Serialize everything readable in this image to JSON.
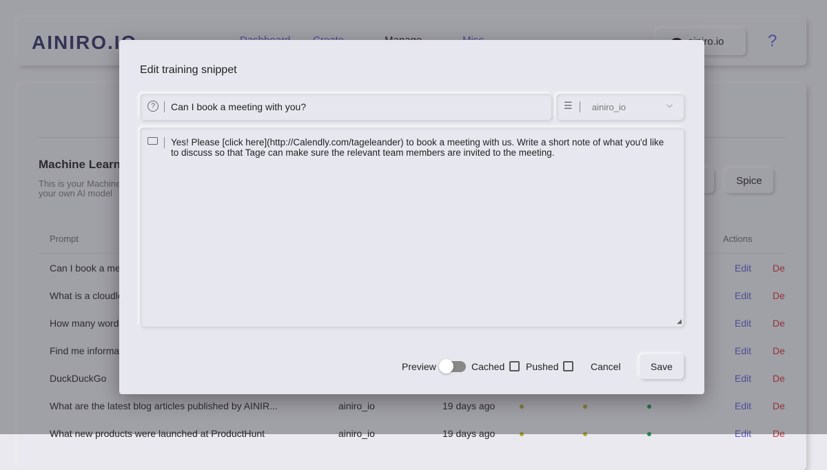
{
  "header": {
    "logo": "AINIRO.IO",
    "nav": [
      "Dashboard",
      "Create",
      "Manage",
      "Misc"
    ],
    "tenant": "ainiro.io",
    "help": "?"
  },
  "main": {
    "title": "Machine Learning",
    "description": [
      "This is your Machine Learning",
      "your own AI model"
    ],
    "buttons": {
      "spice": "Spice"
    },
    "columns": {
      "prompt": "Prompt",
      "actions": "Actions"
    },
    "rows": [
      {
        "prompt": "Can I book a meeting with you?",
        "edit": "Edit",
        "del": "De"
      },
      {
        "prompt": "What is a cloudless",
        "edit": "Edit",
        "del": "De"
      },
      {
        "prompt": "How many words",
        "edit": "Edit",
        "del": "De"
      },
      {
        "prompt": "Find me information",
        "edit": "Edit",
        "del": "De"
      },
      {
        "prompt": "DuckDuckGo",
        "edit": "Edit",
        "del": "De"
      },
      {
        "prompt": "What are the latest blog articles published by AINIR...",
        "type": "ainiro_io",
        "created": "19 days ago",
        "edit": "Edit",
        "del": "De"
      },
      {
        "prompt": "What new products were launched at ProductHunt",
        "type": "ainiro_io",
        "created": "19 days ago",
        "edit": "Edit",
        "del": "De"
      }
    ],
    "status_colors": {
      "yellow": "#b8a92a",
      "green": "#1e9a50"
    }
  },
  "modal": {
    "title": "Edit training snippet",
    "prompt_value": "Can I book a meeting with you?",
    "type_value": "ainiro_io",
    "completion_value": "Yes! Please [click here](http://Calendly.com/tageleander) to book a meeting with us. Write a short note of what you'd like to discuss so that Tage can make sure the relevant team members are invited to the meeting.",
    "preview_label": "Preview",
    "preview_on": false,
    "cached_label": "Cached",
    "cached_checked": false,
    "pushed_label": "Pushed",
    "pushed_checked": false,
    "cancel": "Cancel",
    "save": "Save"
  }
}
